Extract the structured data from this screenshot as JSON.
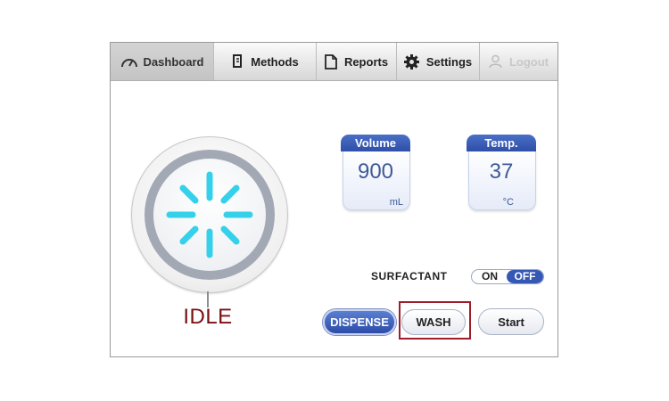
{
  "tabs": {
    "dashboard": "Dashboard",
    "methods": "Methods",
    "reports": "Reports",
    "settings": "Settings",
    "logout": "Logout"
  },
  "status": {
    "label": "IDLE",
    "icon": "loading-spinner-icon"
  },
  "gauges": {
    "volume": {
      "title": "Volume",
      "value": "900",
      "unit": "mL"
    },
    "temp": {
      "title": "Temp.",
      "value": "37",
      "unit": "°C"
    }
  },
  "surfactant": {
    "label": "SURFACTANT",
    "on_label": "ON",
    "off_label": "OFF",
    "state": "OFF"
  },
  "buttons": {
    "dispense": "DISPENSE",
    "wash": "WASH",
    "start": "Start"
  },
  "colors": {
    "accent_blue": "#3558b5",
    "spinner": "#35d0ea",
    "status_text": "#7a0f12",
    "highlight": "#9d1e2a"
  }
}
